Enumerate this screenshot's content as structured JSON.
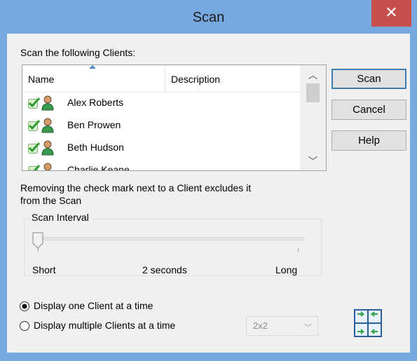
{
  "window": {
    "title": "Scan"
  },
  "list": {
    "caption": "Scan the following Clients:",
    "columns": {
      "name": "Name",
      "description": "Description"
    },
    "rows": [
      {
        "name": "Alex Roberts"
      },
      {
        "name": "Ben Prowen"
      },
      {
        "name": "Beth Hudson"
      },
      {
        "name": "Charlie Keane"
      }
    ]
  },
  "buttons": {
    "scan": "Scan",
    "cancel": "Cancel",
    "help": "Help"
  },
  "info_text": "Removing the check mark next to a Client excludes it",
  "info_text_2": "from the Scan",
  "scan_interval": {
    "label": "Scan Interval",
    "min_label": "Short",
    "max_label": "Long",
    "value_label": "2 seconds",
    "position_fraction": 0
  },
  "display": {
    "option_one": "Display one Client at a time",
    "option_multiple": "Display multiple Clients at a time",
    "selected": "one",
    "layout_value": "2x2"
  },
  "icons": {
    "close": "close-icon",
    "check": "check-icon",
    "user": "user-icon",
    "multi_view": "multi-view-icon"
  }
}
